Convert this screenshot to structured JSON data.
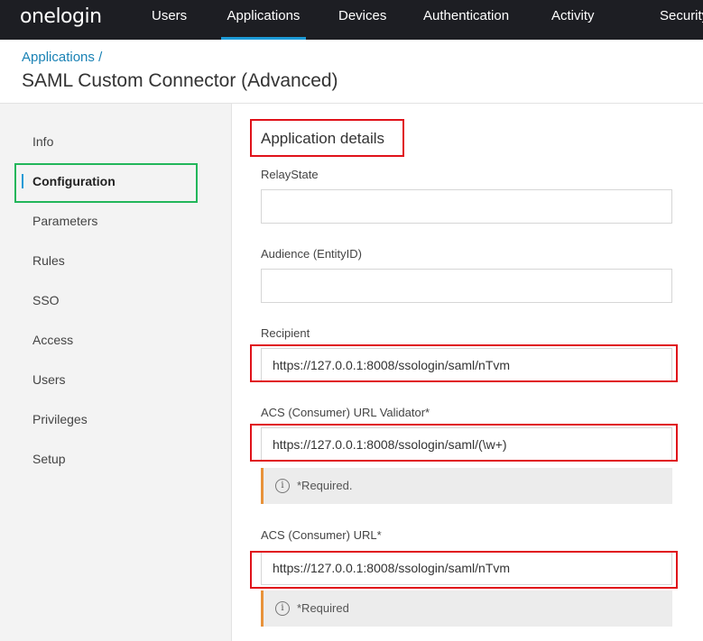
{
  "brand": {
    "logo": "onelogin"
  },
  "nav": {
    "users": "Users",
    "applications": "Applications",
    "devices": "Devices",
    "authentication": "Authentication",
    "activity": "Activity",
    "security": "Security",
    "active": "Applications",
    "accent_color": "#1c9ad6"
  },
  "header": {
    "breadcrumb": "Applications",
    "breadcrumb_sep": "/",
    "title": "SAML Custom Connector (Advanced)"
  },
  "sidebar": {
    "items": [
      {
        "label": "Info"
      },
      {
        "label": "Configuration",
        "active": true
      },
      {
        "label": "Parameters"
      },
      {
        "label": "Rules"
      },
      {
        "label": "SSO"
      },
      {
        "label": "Access"
      },
      {
        "label": "Users"
      },
      {
        "label": "Privileges"
      },
      {
        "label": "Setup"
      }
    ]
  },
  "main": {
    "section_title": "Application details",
    "relay_state": {
      "label": "RelayState",
      "value": ""
    },
    "audience": {
      "label": "Audience (EntityID)",
      "value": ""
    },
    "recipient": {
      "label": "Recipient",
      "value": "https://127.0.0.1:8008/ssologin/saml/nTvm"
    },
    "acs_validator": {
      "label": "ACS (Consumer) URL Validator*",
      "value": "https://127.0.0.1:8008/ssologin/saml/(\\w+)",
      "notice": "*Required."
    },
    "acs_url": {
      "label": "ACS (Consumer) URL*",
      "value": "https://127.0.0.1:8008/ssologin/saml/nTvm",
      "notice": "*Required"
    }
  },
  "highlight_colors": {
    "red": "#e0121a",
    "green": "#22b65a",
    "notice_accent": "#e8923a"
  }
}
